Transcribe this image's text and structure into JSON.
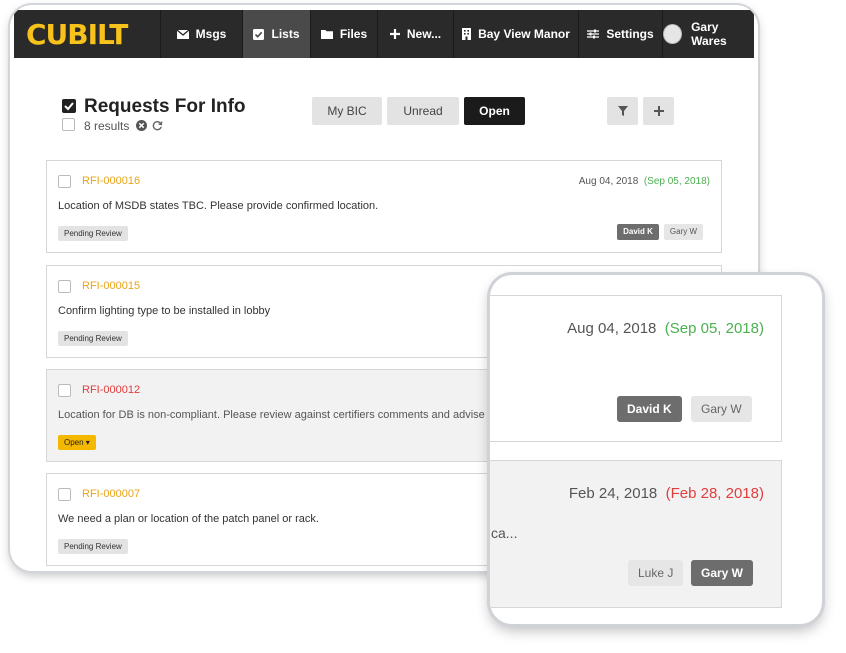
{
  "nav": {
    "logo": "CUBILT",
    "items": [
      {
        "label": "Msgs",
        "icon": "envelope-icon"
      },
      {
        "label": "Lists",
        "icon": "checkbox-icon"
      },
      {
        "label": "Files",
        "icon": "folder-icon"
      },
      {
        "label": "New...",
        "icon": "plus-icon"
      },
      {
        "label": "Bay View Manor",
        "icon": "building-icon"
      },
      {
        "label": "Settings",
        "icon": "sliders-icon"
      },
      {
        "label": "Gary Wares",
        "icon": "avatar"
      }
    ]
  },
  "page": {
    "title": "Requests For Info",
    "result_count": "8 results",
    "filters": [
      "My BIC",
      "Unread",
      "Open"
    ],
    "active_filter": "Open"
  },
  "colors": {
    "accent": "#f7c21b",
    "id_default": "#e8a418",
    "overdue": "#e03d3d",
    "due_ok": "#4cb050",
    "open_status": "#f5b800"
  },
  "rfis": [
    {
      "id": "RFI-000016",
      "description": "Location of MSDB states TBC. Please provide confirmed location.",
      "status": "Pending Review",
      "date": "Aug 04, 2018",
      "due": "(Sep 05, 2018)",
      "assignees": [
        "David K",
        "Gary W"
      ]
    },
    {
      "id": "RFI-000015",
      "description": "Confirm lighting type to be installed in lobby",
      "status": "Pending Review"
    },
    {
      "id": "RFI-000012",
      "description": "Location for DB is non-compliant. Please review against certifiers comments and advise c",
      "status": "Open ▾"
    },
    {
      "id": "RFI-000007",
      "description": "We need a plan or location of the patch panel or rack.",
      "status": "Pending Review"
    }
  ],
  "zoom": {
    "card1": {
      "date": "Aug 04, 2018",
      "due": "(Sep 05, 2018)",
      "assignees": [
        "David K",
        "Gary W"
      ]
    },
    "card2": {
      "date": "Feb 24, 2018",
      "due": "(Feb 28, 2018)",
      "text_fragment": "ca...",
      "assignees": [
        "Luke J",
        "Gary W"
      ]
    }
  }
}
